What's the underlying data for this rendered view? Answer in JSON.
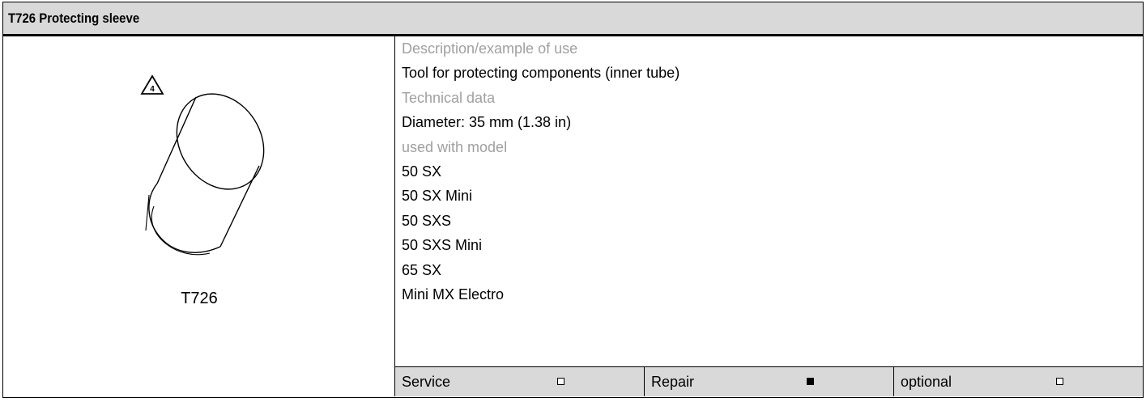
{
  "header": {
    "title": "T726 Protecting sleeve"
  },
  "illustration": {
    "warning_symbol": "4",
    "tool_code": "T726"
  },
  "details": {
    "description_label": "Description/example of use",
    "description": "Tool for protecting components (inner tube)",
    "technical_label": "Technical data",
    "technical": "Diameter: 35 mm (1.38 in)",
    "models_label": "used with model",
    "models": [
      "50 SX",
      "50 SX Mini",
      "50 SXS",
      "50 SXS Mini",
      "65 SX",
      "Mini MX Electro"
    ]
  },
  "footer": {
    "service": {
      "label": "Service",
      "checked": false
    },
    "repair": {
      "label": "Repair",
      "checked": true
    },
    "optional": {
      "label": "optional",
      "checked": false
    }
  }
}
